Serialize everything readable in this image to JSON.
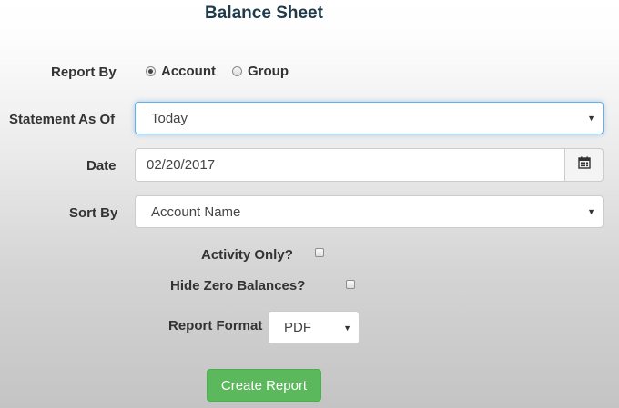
{
  "page": {
    "title": "Balance Sheet"
  },
  "report_by": {
    "label": "Report By",
    "options": [
      "Account",
      "Group"
    ],
    "selected": "Account"
  },
  "statement_as_of": {
    "label": "Statement As Of",
    "value": "Today"
  },
  "date": {
    "label": "Date",
    "value": "02/20/2017"
  },
  "sort_by": {
    "label": "Sort By",
    "value": "Account Name"
  },
  "activity_only": {
    "label": "Activity Only?",
    "checked": false
  },
  "hide_zero_balances": {
    "label": "Hide Zero Balances?",
    "checked": false
  },
  "report_format": {
    "label": "Report Format",
    "value": "PDF"
  },
  "actions": {
    "create_label": "Create Report"
  },
  "colors": {
    "primary_button": "#5cb85c",
    "focus_border": "#66afe9",
    "title": "#1f3a4a"
  },
  "icons": {
    "date_picker": "calendar-icon",
    "dropdown": "caret-down-icon"
  }
}
